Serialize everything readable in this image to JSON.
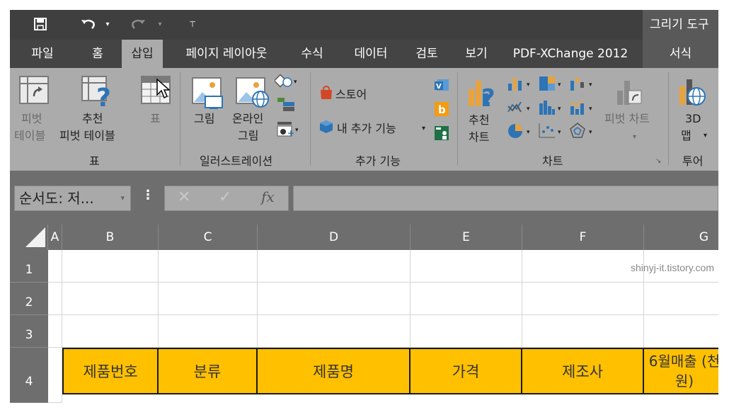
{
  "title_bar": {
    "contextual_tab_title": "그리기 도구"
  },
  "tabs": [
    {
      "label": "파일",
      "active": false
    },
    {
      "label": "홈",
      "active": false
    },
    {
      "label": "삽입",
      "active": true
    },
    {
      "label": "페이지 레이아웃",
      "active": false
    },
    {
      "label": "수식",
      "active": false
    },
    {
      "label": "데이터",
      "active": false
    },
    {
      "label": "검토",
      "active": false
    },
    {
      "label": "보기",
      "active": false
    },
    {
      "label": "PDF-XChange 2012",
      "active": false
    },
    {
      "label": "서식",
      "active": false
    }
  ],
  "ribbon": {
    "pivot_table": {
      "line1": "피벗",
      "line2": "테이블"
    },
    "recommended_pivot": {
      "line1": "추천",
      "line2": "피벗 테이블"
    },
    "table": {
      "label": "표"
    },
    "group_table": "표",
    "picture": {
      "label": "그림"
    },
    "online_picture": {
      "line1": "온라인",
      "line2": "그림"
    },
    "group_illustrations": "일러스트레이션",
    "store": {
      "label": "스토어"
    },
    "my_addins": {
      "label": "내 추가 기능"
    },
    "group_addins": "추가 기능",
    "recommended_charts": {
      "line1": "추천",
      "line2": "차트"
    },
    "pivot_chart": {
      "label": "피벗 차트"
    },
    "group_charts": "차트",
    "map_3d": {
      "line1": "3D",
      "line2": "맵"
    },
    "group_tours": "투어"
  },
  "formula_bar": {
    "name_box": "순서도: 저...",
    "fx_label": "fx",
    "formula_value": ""
  },
  "grid": {
    "columns": [
      "A",
      "B",
      "C",
      "D",
      "E",
      "F",
      "G"
    ],
    "rows": [
      "1",
      "2",
      "3",
      "4"
    ],
    "header_row": [
      "제품번호",
      "분류",
      "제품명",
      "가격",
      "제조사",
      "6월매출 (천원)"
    ]
  },
  "watermark": "shinyj-it.tistory.com",
  "colors": {
    "title_bar": "#3f3f3f",
    "tab_bar": "#444444",
    "ribbon": "#ababab",
    "header_fill": "#ffc000",
    "accent_blue": "#2e74b5"
  }
}
